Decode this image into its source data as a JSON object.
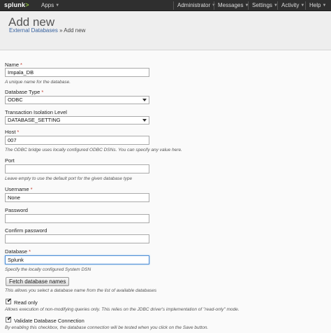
{
  "topbar": {
    "logo_text": "splunk",
    "logo_suffix": ">",
    "apps": "Apps",
    "administrator": "Administrator",
    "messages": "Messages",
    "settings": "Settings",
    "activity": "Activity",
    "help": "Help"
  },
  "header": {
    "title": "Add new",
    "breadcrumb_link": "External Databases",
    "breadcrumb_current": "» Add new"
  },
  "form": {
    "name": {
      "label": "Name",
      "value": "Impala_DB",
      "help": "A unique name for the database."
    },
    "database_type": {
      "label": "Database Type",
      "value": "ODBC"
    },
    "isolation": {
      "label": "Transaction Isolation Level",
      "value": "DATABASE_SETTING"
    },
    "host": {
      "label": "Host",
      "value": "007",
      "help": "The ODBC bridge uses locally configured ODBC DSNs. You can specify any value here."
    },
    "port": {
      "label": "Port",
      "value": "",
      "help": "Leave empty to use the default port for the given database type"
    },
    "username": {
      "label": "Username",
      "value": "None"
    },
    "password": {
      "label": "Password",
      "value": ""
    },
    "confirm_password": {
      "label": "Confirm password",
      "value": ""
    },
    "database": {
      "label": "Database",
      "value": "Splunk",
      "help": "Specify the locally configured System DSN"
    },
    "fetch_button": {
      "label": "Fetch database names",
      "help": "This allows you select a database name from the list of available databases"
    },
    "read_only": {
      "label": "Read only",
      "checked": true,
      "help": "Allows execution of non-modifying queries only. This relies on the JDBC driver's implementation of \"read-only\" mode."
    },
    "validate": {
      "label": "Validate Database Connection",
      "checked": true,
      "help": "By enabling this checkbox, the database connection will be tested when you click on the Save button."
    },
    "required_marker": "*"
  }
}
